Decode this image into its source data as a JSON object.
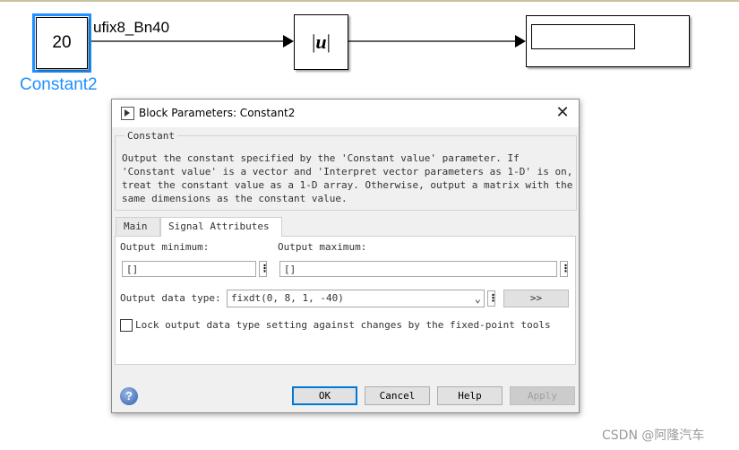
{
  "model": {
    "constant_block": {
      "value": "20",
      "name": "Constant2"
    },
    "signal_label": "ufix8_Bn40",
    "abs_block": {
      "text_left": "|",
      "text_var": "u",
      "text_right": "|"
    },
    "display_block": {
      "value": ""
    }
  },
  "dialog": {
    "title": "Block Parameters: Constant2",
    "description_group": {
      "label": "Constant",
      "text": "Output the constant specified by the 'Constant value' parameter. If\n'Constant value' is a vector and 'Interpret vector parameters as 1-D' is on,\ntreat the constant value as a 1-D array. Otherwise, output a matrix with the\nsame dimensions as the constant value."
    },
    "tabs": [
      {
        "label": "Main",
        "active": false
      },
      {
        "label": "Signal Attributes",
        "active": true
      }
    ],
    "fields": {
      "output_minimum": {
        "label": "Output minimum:",
        "value": "[]"
      },
      "output_maximum": {
        "label": "Output maximum:",
        "value": "[]"
      },
      "output_data_type": {
        "label": "Output data type:",
        "value": "fixdt(0, 8, 1, -40)",
        "assistant_label": ">>"
      },
      "lock_checkbox": {
        "label": "Lock output data type setting against changes by the fixed-point tools",
        "checked": false
      }
    },
    "buttons": {
      "ok": "OK",
      "cancel": "Cancel",
      "help": "Help",
      "apply": "Apply"
    },
    "help_icon_glyph": "?"
  },
  "watermark": "CSDN @阿隆汽车",
  "colors": {
    "selection": "#1e90ff",
    "ok_focus": "#0078d7"
  }
}
